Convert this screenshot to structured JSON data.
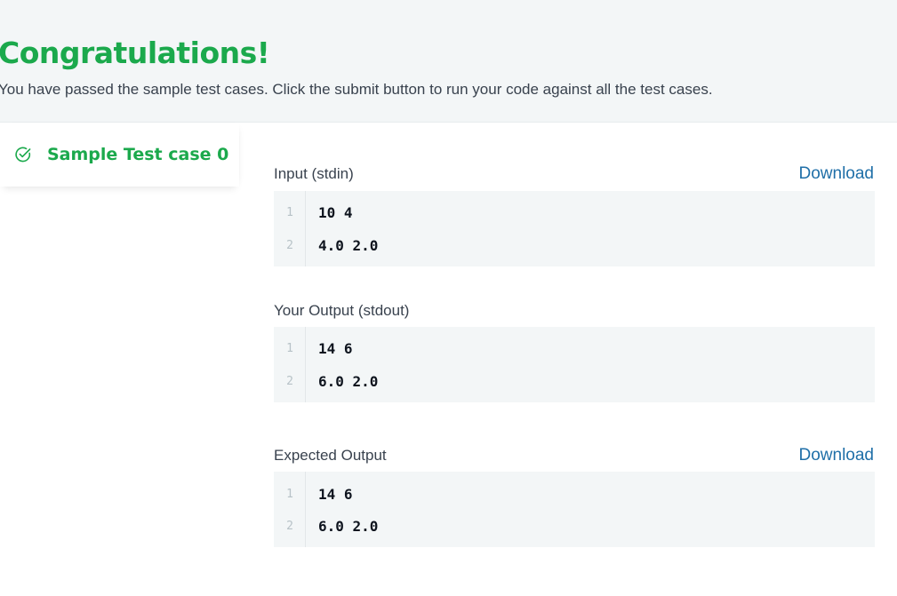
{
  "header": {
    "title": "Congratulations!",
    "subtitle": "You have passed the sample test cases. Click the submit button to run your code against all the test cases."
  },
  "tabs": [
    {
      "label": "Sample Test case 0",
      "status": "passed",
      "icon": "check-circle-icon"
    }
  ],
  "sections": {
    "input": {
      "label": "Input (stdin)",
      "download_label": "Download",
      "lines": [
        {
          "num": "1",
          "text": "10 4"
        },
        {
          "num": "2",
          "text": "4.0 2.0"
        }
      ]
    },
    "output": {
      "label": "Your Output (stdout)",
      "lines": [
        {
          "num": "1",
          "text": "14 6"
        },
        {
          "num": "2",
          "text": "6.0 2.0"
        }
      ]
    },
    "expected": {
      "label": "Expected Output",
      "download_label": "Download",
      "lines": [
        {
          "num": "1",
          "text": "14 6"
        },
        {
          "num": "2",
          "text": "6.0 2.0"
        }
      ]
    }
  },
  "colors": {
    "success": "#1ba94c",
    "link": "#1f6fa8",
    "text": "#39424e",
    "code_bg": "#f3f6f7"
  }
}
